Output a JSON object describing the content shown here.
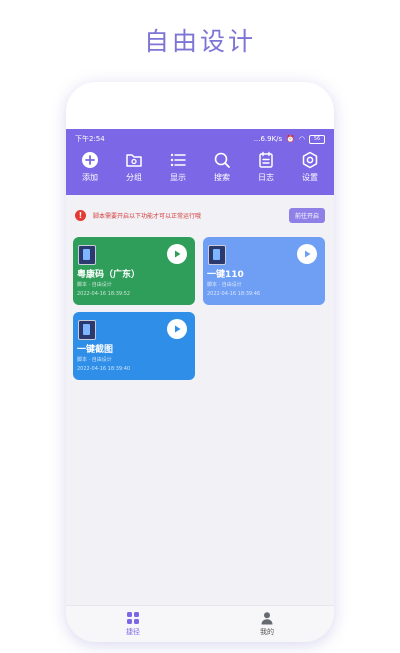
{
  "headline": "自由设计",
  "status": {
    "time": "下午2:54",
    "speed": "...6.9K/s",
    "battery": "56"
  },
  "toolbar": [
    {
      "label": "添加",
      "icon": "add-icon"
    },
    {
      "label": "分组",
      "icon": "folder-icon"
    },
    {
      "label": "显示",
      "icon": "list-icon"
    },
    {
      "label": "搜索",
      "icon": "search-icon"
    },
    {
      "label": "日志",
      "icon": "log-icon"
    },
    {
      "label": "设置",
      "icon": "gear-icon"
    }
  ],
  "notice": {
    "text": "脚本需要开启以下功能才可以正常运行哦",
    "button": "前往开启"
  },
  "cards": [
    {
      "title": "粤康码（广东）",
      "sub": "脚本 · 自由设计",
      "time": "2022-04-16 18:39:52",
      "color": "#2f9e5a"
    },
    {
      "title": "一键110",
      "sub": "脚本 · 自由设计",
      "time": "2022-04-16 18:39:46",
      "color": "#6f9ef5"
    },
    {
      "title": "一键截图",
      "sub": "脚本 · 自由设计",
      "time": "2022-04-16 18:39:40",
      "color": "#2e8ee8"
    }
  ],
  "tabs": [
    {
      "label": "捷径",
      "icon": "grid-icon",
      "active": true
    },
    {
      "label": "我的",
      "icon": "person-icon",
      "active": false
    }
  ],
  "colors": {
    "brand": "#7c68e6",
    "headline": "#7d74d6",
    "alert": "#e53935"
  }
}
